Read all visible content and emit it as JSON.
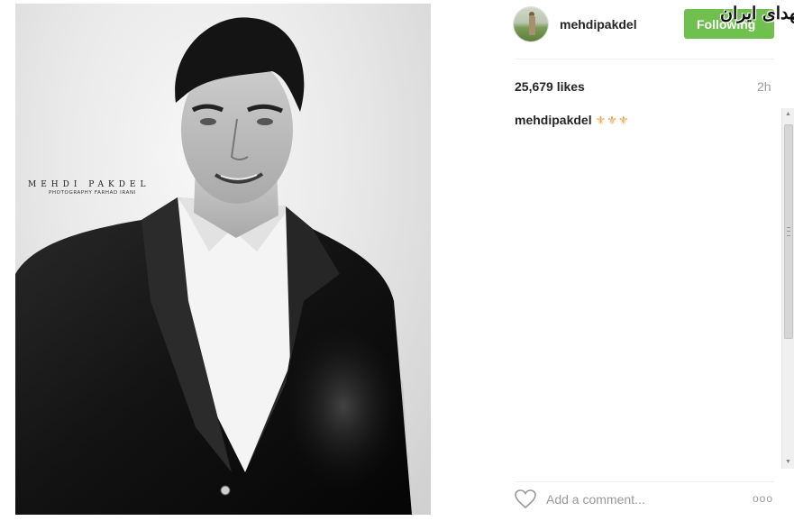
{
  "photo": {
    "watermark_name": "MEHDI PAKDEL",
    "watermark_credit": "PHOTOGRAPHY FARHAD IRANI"
  },
  "header": {
    "username": "mehdipakdel",
    "follow_label": "Following",
    "overlay_logo": "شهدای ایران"
  },
  "stats": {
    "likes": "25,679 likes",
    "time": "2h"
  },
  "caption": {
    "user": "mehdipakdel",
    "text": "⚜⚜⚜"
  },
  "comment": {
    "placeholder": "Add a comment...",
    "more": "ooo"
  },
  "icons": [
    "heart-icon",
    "more-options-icon",
    "scroll-up-icon",
    "scroll-down-icon"
  ],
  "colors": {
    "follow_button": "#70c050",
    "caption_emoji": "#e0a040",
    "muted_text": "#999999"
  }
}
